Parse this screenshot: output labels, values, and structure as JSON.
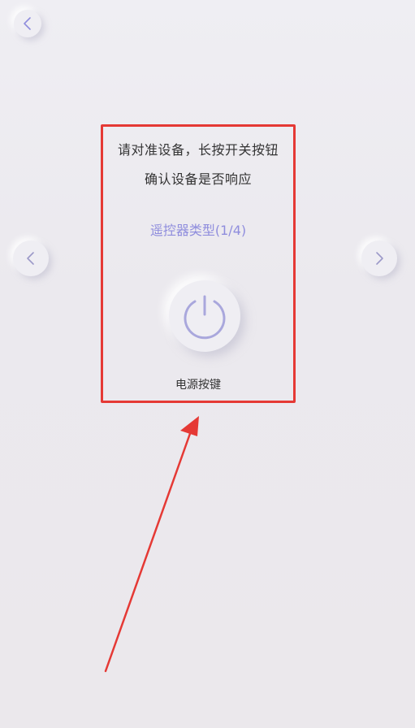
{
  "nav": {
    "back_icon": "chevron-left-icon",
    "prev_icon": "chevron-left-icon",
    "next_icon": "chevron-right-icon"
  },
  "card": {
    "instruction_line1": "请对准设备，长按开关按钮",
    "instruction_line2": "确认设备是否响应",
    "remote_type_label": "遥控器类型(1/4)",
    "power_icon": "power-icon",
    "power_label": "电源按键"
  },
  "colors": {
    "accent": "#8f8ddd",
    "highlight": "#e53935",
    "text": "#333333",
    "background": "#eceaef"
  }
}
